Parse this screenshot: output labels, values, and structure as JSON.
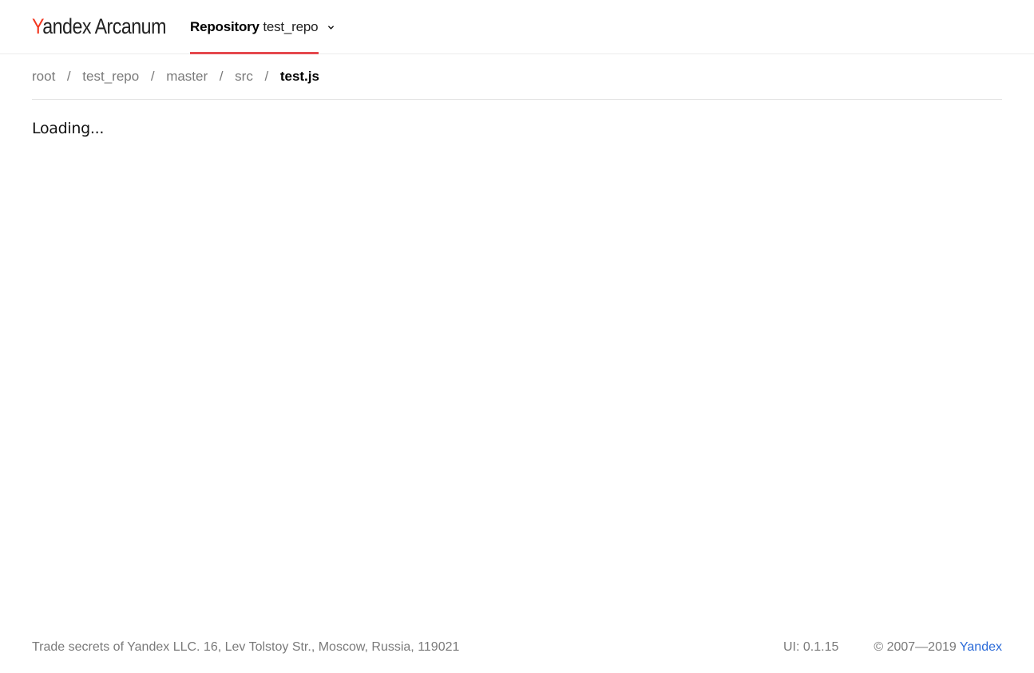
{
  "header": {
    "logo": {
      "first_letter": "Y",
      "rest": "andex Arcanum"
    },
    "repo_selector": {
      "keyword": "Repository",
      "value": "test_repo",
      "icon": "chevron-down-icon",
      "accent_color": "#e5484d"
    }
  },
  "breadcrumb": {
    "separator": "/",
    "items": [
      {
        "label": "root"
      },
      {
        "label": "test_repo"
      },
      {
        "label": "master"
      },
      {
        "label": "src"
      },
      {
        "label": "test.js"
      }
    ]
  },
  "main": {
    "status": "Loading..."
  },
  "footer": {
    "legal": "Trade secrets of Yandex LLC. 16, Lev Tolstoy Str., Moscow, Russia, 119021",
    "version": "UI: 0.1.15",
    "copyright_prefix": "© 2007—2019",
    "copyright_link": "Yandex",
    "link_color": "#2a6ad8"
  }
}
